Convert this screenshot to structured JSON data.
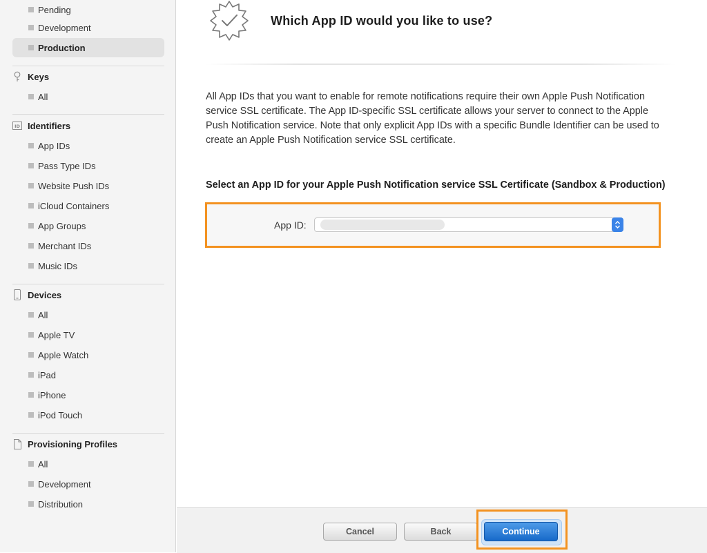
{
  "sidebar": {
    "certificates_tail": [
      {
        "label": "Pending"
      },
      {
        "label": "Development"
      },
      {
        "label": "Production",
        "active": true
      }
    ],
    "keys": {
      "heading": "Keys",
      "items": [
        {
          "label": "All"
        }
      ]
    },
    "identifiers": {
      "heading": "Identifiers",
      "icon_text": "ID",
      "items": [
        {
          "label": "App IDs"
        },
        {
          "label": "Pass Type IDs"
        },
        {
          "label": "Website Push IDs"
        },
        {
          "label": "iCloud Containers"
        },
        {
          "label": "App Groups"
        },
        {
          "label": "Merchant IDs"
        },
        {
          "label": "Music IDs"
        }
      ]
    },
    "devices": {
      "heading": "Devices",
      "items": [
        {
          "label": "All"
        },
        {
          "label": "Apple TV"
        },
        {
          "label": "Apple Watch"
        },
        {
          "label": "iPad"
        },
        {
          "label": "iPhone"
        },
        {
          "label": "iPod Touch"
        }
      ]
    },
    "profiles": {
      "heading": "Provisioning Profiles",
      "items": [
        {
          "label": "All"
        },
        {
          "label": "Development"
        },
        {
          "label": "Distribution"
        }
      ]
    }
  },
  "main": {
    "title": "Which App ID would you like to use?",
    "description": "All App IDs that you want to enable for remote notifications require their own Apple Push Notification service SSL certificate. The App ID-specific SSL certificate allows your server to connect to the Apple Push Notification service. Note that only explicit App IDs with a specific Bundle Identifier can be used to create an Apple Push Notification service SSL certificate.",
    "section_heading": "Select an App ID for your Apple Push Notification service SSL Certificate (Sandbox & Production)",
    "app_id_label": "App ID:",
    "app_id_value": ""
  },
  "footer": {
    "cancel": "Cancel",
    "back": "Back",
    "continue": "Continue"
  },
  "colors": {
    "highlight": "#f39220",
    "primary_button": "#1769c9",
    "active_item_bg": "#e2e2e2"
  }
}
